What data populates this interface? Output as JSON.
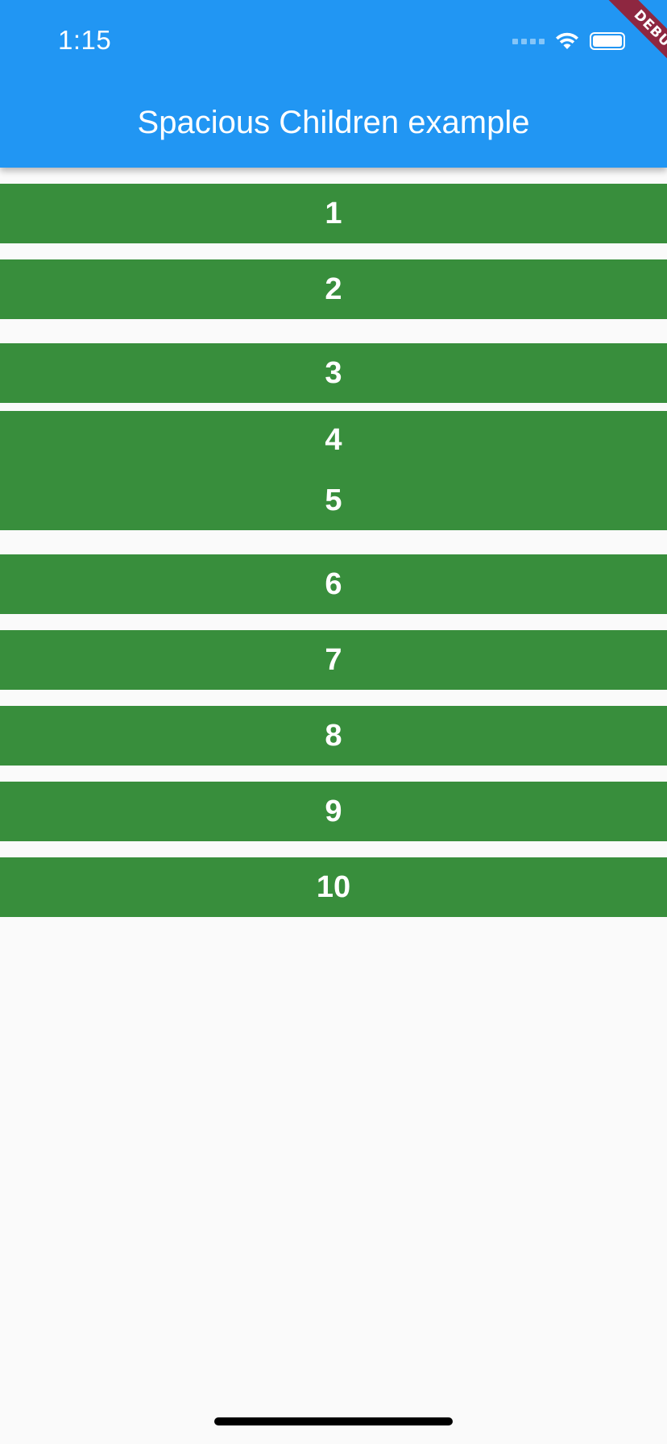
{
  "status_bar": {
    "time": "1:15"
  },
  "app_bar": {
    "title": "Spacious Children example",
    "color": "#2196f3"
  },
  "debug_banner": {
    "label": "DEBUG",
    "color": "#8e2740"
  },
  "list": {
    "item_color": "#388e3c",
    "items": [
      {
        "label": "1"
      },
      {
        "label": "2"
      },
      {
        "label": "3"
      },
      {
        "label": "4"
      },
      {
        "label": "5"
      },
      {
        "label": "6"
      },
      {
        "label": "7"
      },
      {
        "label": "8"
      },
      {
        "label": "9"
      },
      {
        "label": "10"
      }
    ]
  },
  "icons": {
    "signal": "cellular-signal-icon",
    "wifi": "wifi-icon",
    "battery": "battery-icon"
  }
}
